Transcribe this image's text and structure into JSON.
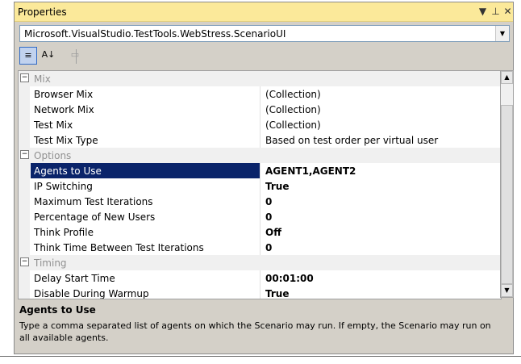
{
  "window": {
    "title": "Properties",
    "buttons": {
      "dropdown": "▼",
      "pin": "⊥",
      "close": "✕"
    }
  },
  "object_selector": {
    "value": "Microsoft.VisualStudio.TestTools.WebStress.ScenarioUI",
    "arrow": "▼"
  },
  "toolbar": {
    "categorized": "≡",
    "alphabetical": "A↓",
    "property_pages": "▭"
  },
  "grid": {
    "categories": [
      {
        "expander": "−",
        "label": "Mix"
      },
      {
        "expander": "−",
        "label": "Options"
      },
      {
        "expander": "−",
        "label": "Timing"
      }
    ],
    "mix": [
      {
        "name": "Browser Mix",
        "value": "(Collection)"
      },
      {
        "name": "Network Mix",
        "value": "(Collection)"
      },
      {
        "name": "Test Mix",
        "value": "(Collection)"
      },
      {
        "name": "Test Mix Type",
        "value": "Based on test order per virtual user"
      }
    ],
    "options": [
      {
        "name": "Agents to Use",
        "value": "AGENT1,AGENT2"
      },
      {
        "name": "IP Switching",
        "value": "True"
      },
      {
        "name": "Maximum Test Iterations",
        "value": "0"
      },
      {
        "name": "Percentage of New Users",
        "value": "0"
      },
      {
        "name": "Think Profile",
        "value": "Off"
      },
      {
        "name": "Think Time Between Test Iterations",
        "value": "0"
      }
    ],
    "timing": [
      {
        "name": "Delay Start Time",
        "value": "00:01:00"
      },
      {
        "name": "Disable During Warmup",
        "value": "True"
      }
    ]
  },
  "scrollbar": {
    "up": "▲",
    "down": "▼"
  },
  "description": {
    "title": "Agents to Use",
    "text": "Type a comma separated list of agents on which the Scenario may run. If empty, the Scenario may run on all available agents."
  }
}
